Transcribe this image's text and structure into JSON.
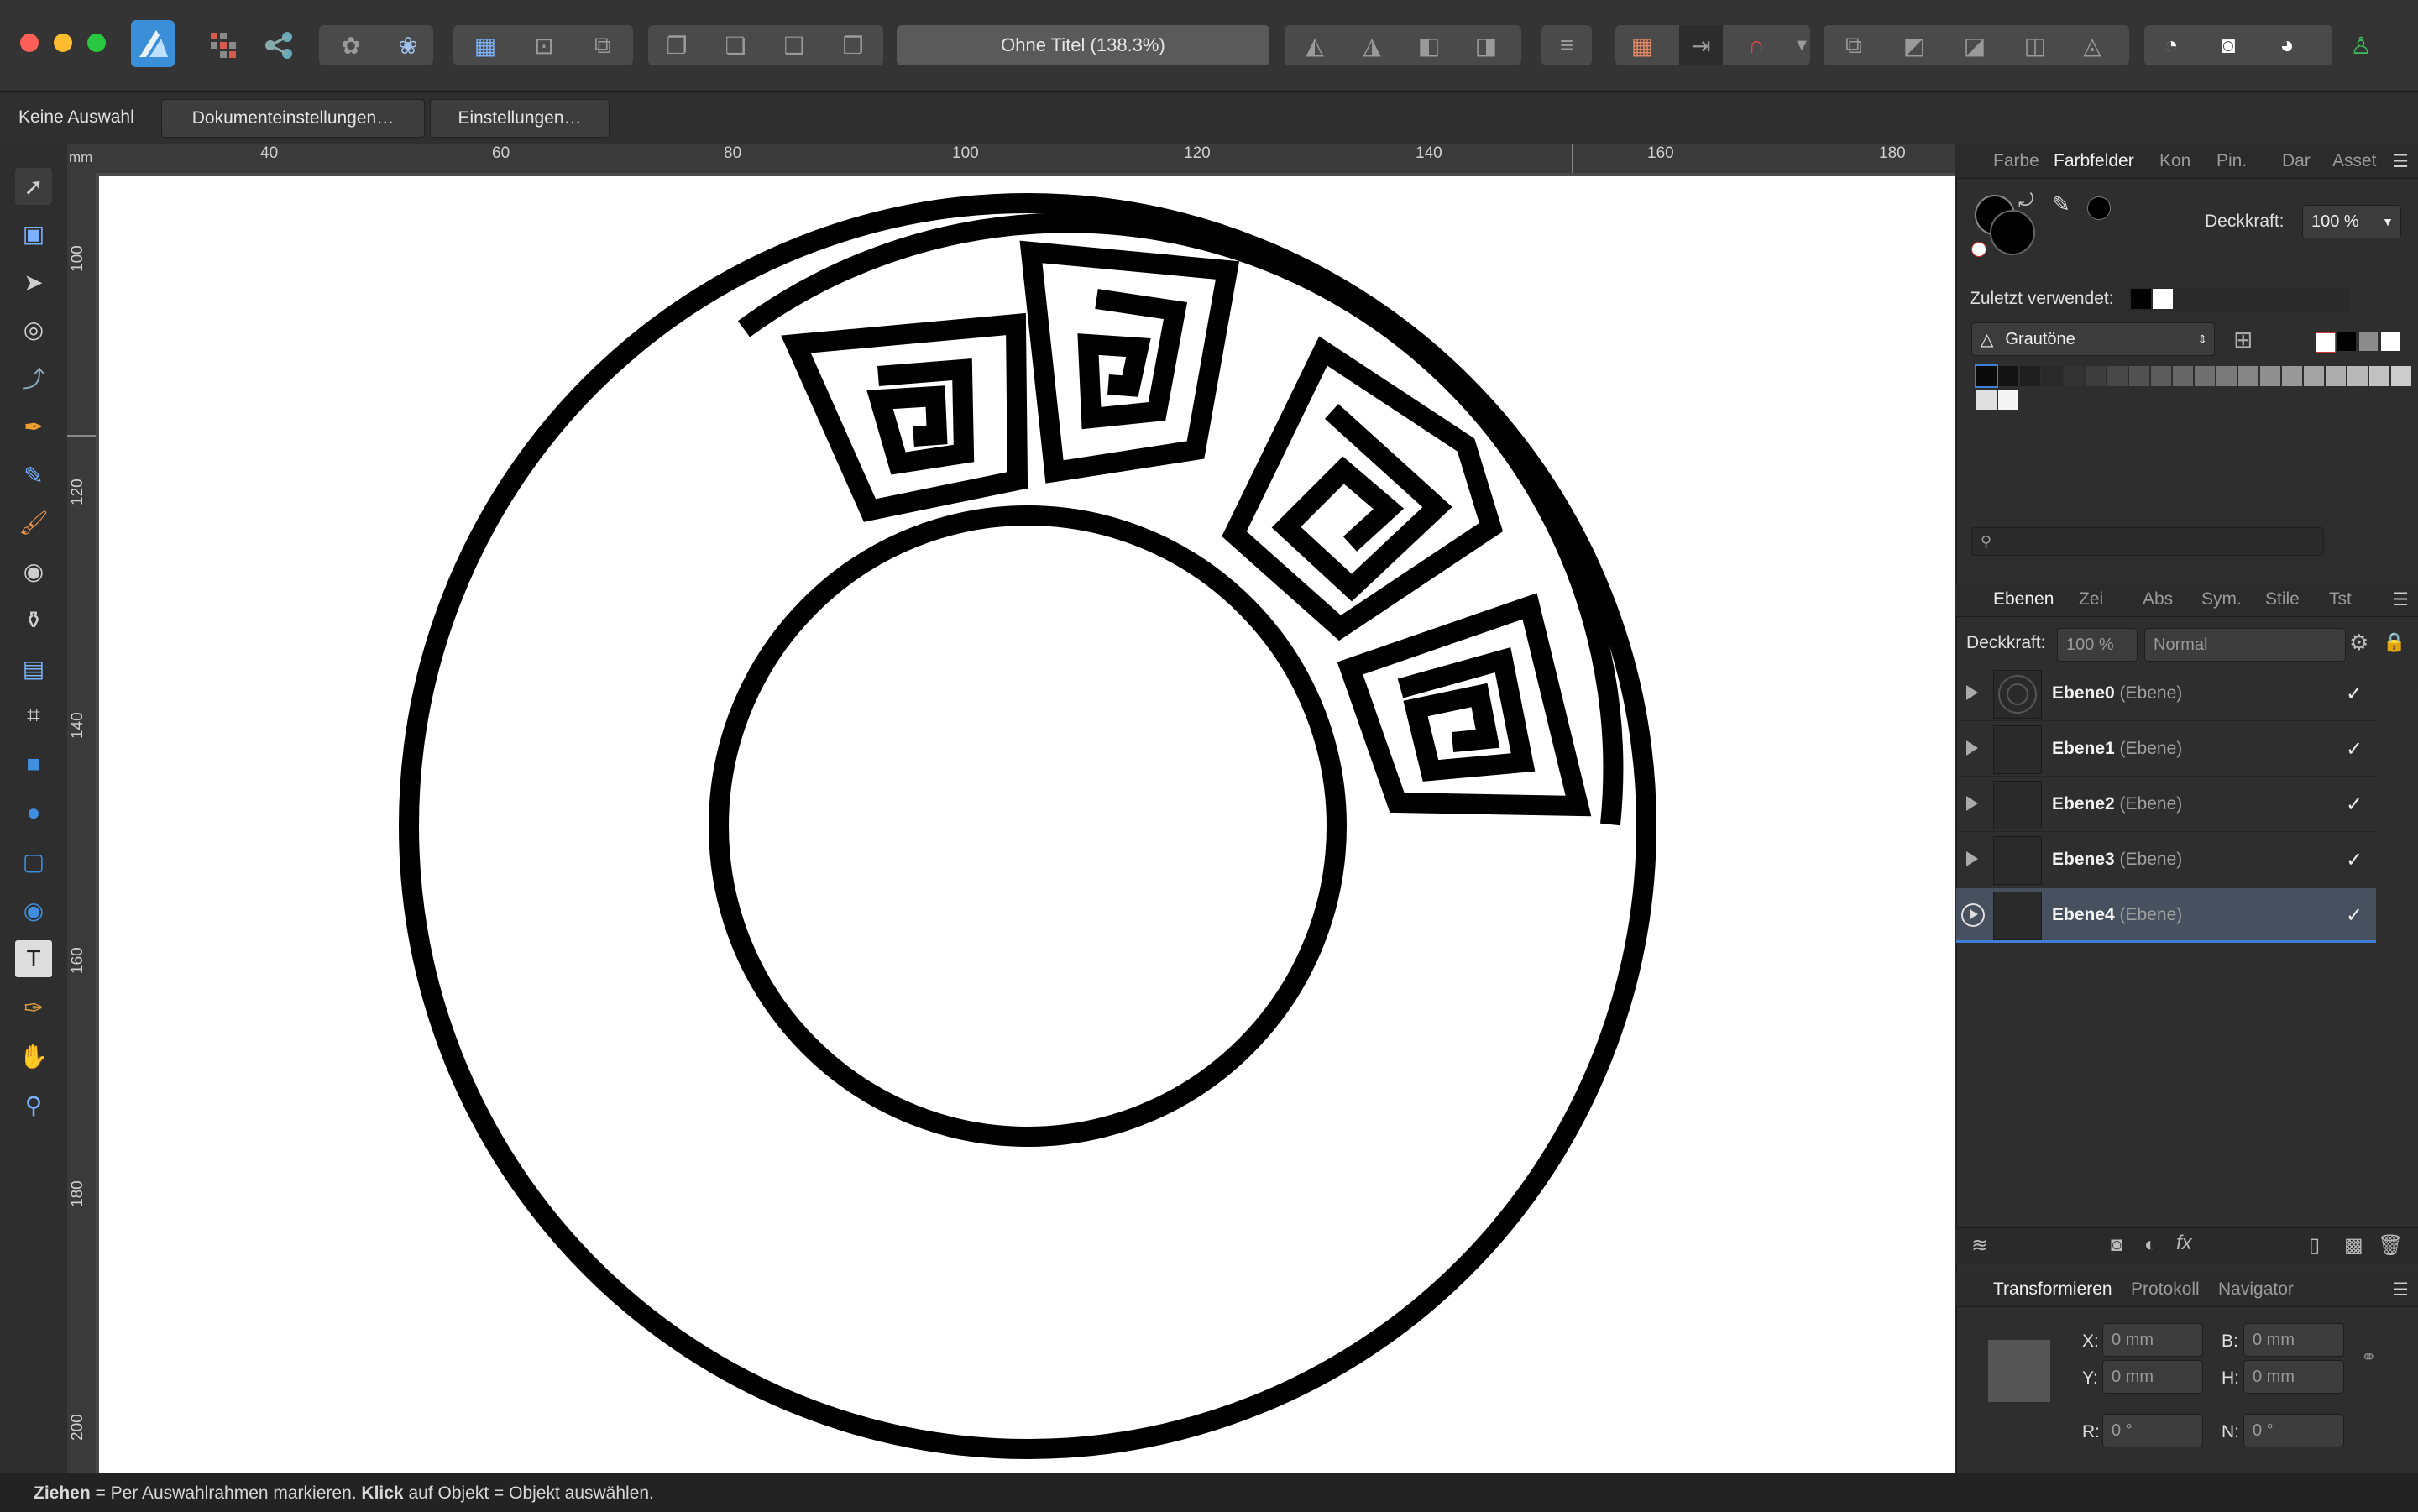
{
  "window": {
    "title": "Ohne Titel (138.3%)"
  },
  "context": {
    "selection": "Keine Auswahl",
    "doc_settings": "Dokumenteinstellungen…",
    "settings": "Einstellungen…"
  },
  "ruler": {
    "unit": "mm",
    "top": [
      "40",
      "60",
      "80",
      "100",
      "120",
      "140",
      "160",
      "180"
    ],
    "left": [
      "100",
      "120",
      "140",
      "160",
      "180",
      "200"
    ]
  },
  "color_panel": {
    "tabs": [
      "Farbe",
      "Farbfelder",
      "Kon",
      "Pin.",
      "Dar",
      "Asset"
    ],
    "active_tab": "Farbfelder",
    "opacity_label": "Deckkraft:",
    "opacity_value": "100 %",
    "recent_label": "Zuletzt verwendet:",
    "palette_name": "Grautöne",
    "swatches": [
      "#0a0a0a",
      "#141414",
      "#1f1f1f",
      "#292929",
      "#333333",
      "#3d3d3d",
      "#474747",
      "#525252",
      "#5c5c5c",
      "#666666",
      "#707070",
      "#7a7a7a",
      "#858585",
      "#8f8f8f",
      "#999999",
      "#a3a3a3",
      "#adadad",
      "#b8b8b8",
      "#c2c2c2",
      "#cccccc",
      "#e0e0e0",
      "#f5f5f5"
    ]
  },
  "layers_panel": {
    "tabs": [
      "Ebenen",
      "Zei",
      "Abs",
      "Sym.",
      "Stile",
      "Tst"
    ],
    "active_tab": "Ebenen",
    "opacity_label": "Deckkraft:",
    "opacity_value": "100 %",
    "blend_mode": "Normal",
    "layers": [
      {
        "name": "Ebene0",
        "type": "(Ebene)",
        "visible": true
      },
      {
        "name": "Ebene1",
        "type": "(Ebene)",
        "visible": true
      },
      {
        "name": "Ebene2",
        "type": "(Ebene)",
        "visible": true
      },
      {
        "name": "Ebene3",
        "type": "(Ebene)",
        "visible": true
      },
      {
        "name": "Ebene4",
        "type": "(Ebene)",
        "visible": true,
        "selected": true
      }
    ]
  },
  "transform_panel": {
    "tabs": [
      "Transformieren",
      "Protokoll",
      "Navigator"
    ],
    "active_tab": "Transformieren",
    "x_label": "X:",
    "x_value": "0 mm",
    "y_label": "Y:",
    "y_value": "0 mm",
    "b_label": "B:",
    "b_value": "0 mm",
    "h_label": "H:",
    "h_value": "0 mm",
    "r_label": "R:",
    "r_value": "0 °",
    "n_label": "N:",
    "n_value": "0 °"
  },
  "status": {
    "drag": "Ziehen",
    "drag_text": " = Per Auswahlrahmen markieren. ",
    "click": "Klick",
    "click_text": " auf Objekt = Objekt auswählen."
  },
  "colors": {
    "accent": "#3f7fd6",
    "panel": "#2e2e2e",
    "artboard": "#ffffff"
  }
}
